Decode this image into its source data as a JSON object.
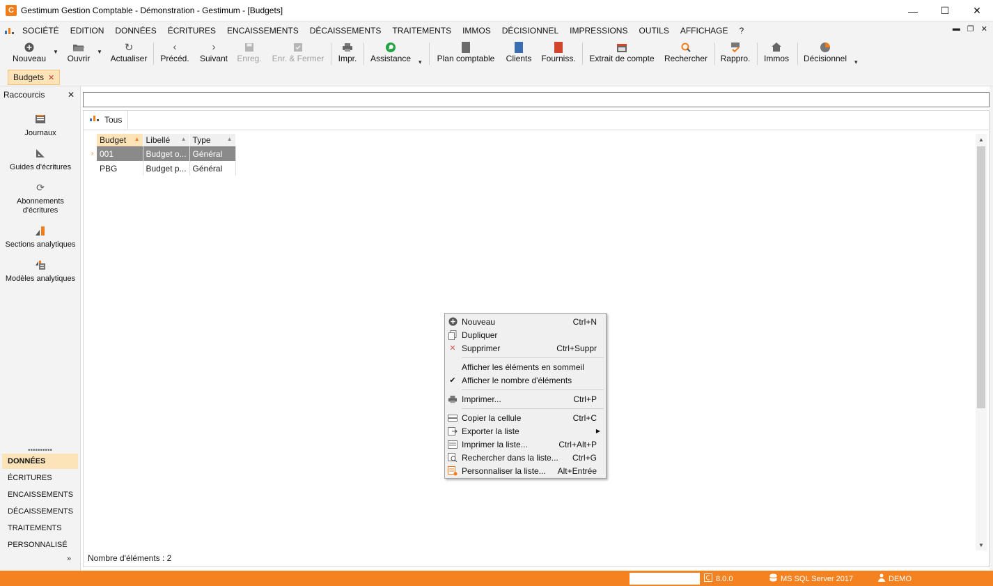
{
  "window": {
    "title": "Gestimum Gestion Comptable - Démonstration - Gestimum - [Budgets]",
    "logo_letter": "C"
  },
  "menu": [
    "SOCIÉTÉ",
    "EDITION",
    "DONNÉES",
    "ÉCRITURES",
    "ENCAISSEMENTS",
    "DÉCAISSEMENTS",
    "TRAITEMENTS",
    "IMMOS",
    "DÉCISIONNEL",
    "IMPRESSIONS",
    "OUTILS",
    "AFFICHAGE",
    "?"
  ],
  "toolbar": {
    "nouveau": "Nouveau",
    "ouvrir": "Ouvrir",
    "actualiser": "Actualiser",
    "preced": "Précéd.",
    "suivant": "Suivant",
    "enreg": "Enreg.",
    "enr_fermer": "Enr. & Fermer",
    "impr": "Impr.",
    "assistance": "Assistance",
    "plan_comptable": "Plan comptable",
    "clients": "Clients",
    "fourniss": "Fourniss.",
    "extrait": "Extrait de compte",
    "rechercher": "Rechercher",
    "rappro": "Rappro.",
    "immos": "Immos",
    "decisionnel": "Décisionnel"
  },
  "doc_tab": "Budgets",
  "sidebar": {
    "title": "Raccourcis",
    "shortcuts": [
      {
        "label": "Journaux"
      },
      {
        "label": "Guides d'écritures"
      },
      {
        "label": "Abonnements d'écritures"
      },
      {
        "label": "Sections analytiques"
      },
      {
        "label": "Modèles analytiques"
      }
    ],
    "nav": [
      "DONNÉES",
      "ÉCRITURES",
      "ENCAISSEMENTS",
      "DÉCAISSEMENTS",
      "TRAITEMENTS",
      "PERSONNALISÉ"
    ],
    "grip": "••••••••••"
  },
  "view_tab": "Tous",
  "grid": {
    "columns": [
      "Budget",
      "Libellé",
      "Type"
    ],
    "rows": [
      [
        "001",
        "Budget o...",
        "Général"
      ],
      [
        "PBG",
        "Budget p...",
        "Général"
      ]
    ]
  },
  "count_text": "Nombre d'éléments : 2",
  "context_menu": [
    {
      "label": "Nouveau",
      "shortcut": "Ctrl+N"
    },
    {
      "label": "Dupliquer",
      "shortcut": ""
    },
    {
      "label": "Supprimer",
      "shortcut": "Ctrl+Suppr"
    },
    {
      "label": "Afficher les éléments en sommeil",
      "shortcut": ""
    },
    {
      "label": "Afficher le nombre d'éléments",
      "shortcut": ""
    },
    {
      "label": "Imprimer...",
      "shortcut": "Ctrl+P"
    },
    {
      "label": "Copier la cellule",
      "shortcut": "Ctrl+C"
    },
    {
      "label": "Exporter la liste",
      "shortcut": ""
    },
    {
      "label": "Imprimer la liste...",
      "shortcut": "Ctrl+Alt+P"
    },
    {
      "label": "Rechercher dans la liste...",
      "shortcut": "Ctrl+G"
    },
    {
      "label": "Personnaliser la liste...",
      "shortcut": "Alt+Entrée"
    }
  ],
  "status": {
    "version": "8.0.0",
    "server": "MS SQL Server 2017",
    "user": "DEMO"
  },
  "colors": {
    "accent": "#f58220",
    "highlight": "#fde4b8",
    "selected_row": "#8a8a8a"
  }
}
